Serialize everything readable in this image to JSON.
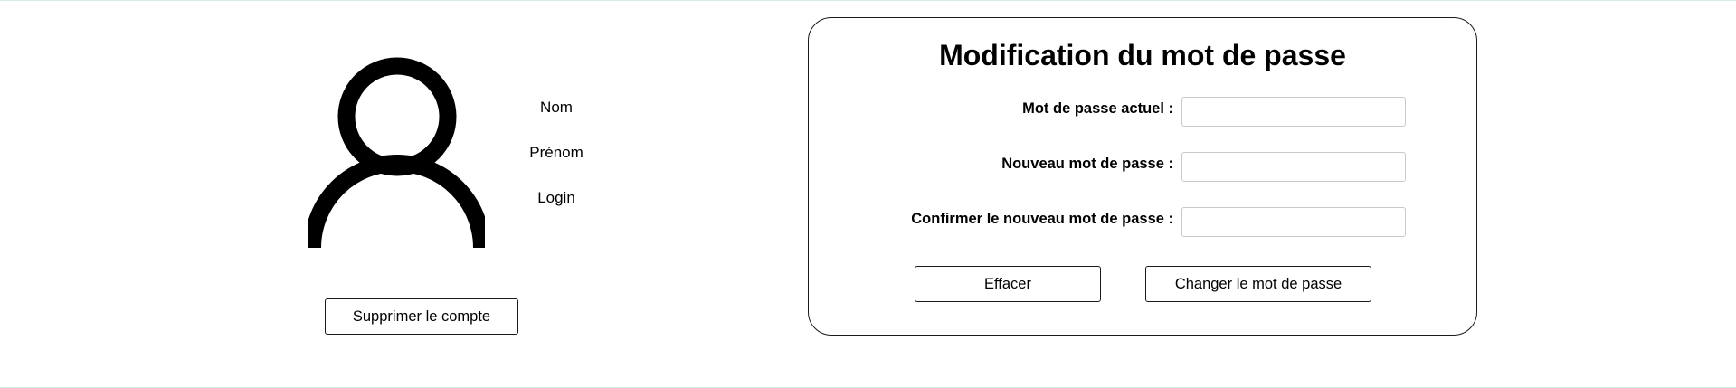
{
  "profile": {
    "fields": [
      "Nom",
      "Prénom",
      "Login"
    ],
    "delete_button": "Supprimer le compte"
  },
  "password_form": {
    "title": "Modification du mot de passe",
    "current_password": {
      "label": "Mot de passe actuel :",
      "value": "",
      "placeholder": ""
    },
    "new_password": {
      "label": "Nouveau mot de passe :",
      "value": "",
      "placeholder": ""
    },
    "confirm_password": {
      "label": "Confirmer le nouveau mot de passe :",
      "value": "",
      "placeholder": ""
    },
    "clear_button": "Effacer",
    "submit_button": "Changer le mot de passe"
  },
  "icons": {
    "avatar": "user-silhouette-icon"
  }
}
